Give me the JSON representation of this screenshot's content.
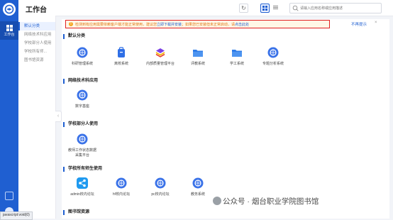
{
  "app": {
    "nav_label": "工作台",
    "title": "工作台"
  },
  "toolbar": {
    "search_placeholder": "请输入应用名称或应用描述"
  },
  "sidebar": {
    "items": [
      {
        "label": "默认分类",
        "active": true
      },
      {
        "label": "网络技术科应用",
        "active": false
      },
      {
        "label": "学校部分人使用",
        "active": false
      },
      {
        "label": "学校所有师...",
        "active": false
      },
      {
        "label": "图书馆资源",
        "active": false
      }
    ]
  },
  "notice": {
    "text_before": "检测到有应用需要依赖客户端才能正常使用，建议您",
    "link1": "立即下载并安装",
    "text_mid": "；如果您已安装但未正常启动，请",
    "link2": "点击此处",
    "no_remind": "不再提示",
    "close": "×"
  },
  "sections": [
    {
      "title": "默认分类",
      "apps": [
        {
          "label": "科研管理系统",
          "icon": "globe-icon"
        },
        {
          "label": "离校系统",
          "icon": "bag-icon"
        },
        {
          "label": "内部质量管理平台",
          "icon": "layers-icon"
        },
        {
          "label": "评教系统",
          "icon": "folder-icon"
        },
        {
          "label": "学工系统",
          "icon": "folder-icon"
        },
        {
          "label": "专题分析系统",
          "icon": "globe-icon"
        }
      ]
    },
    {
      "title": "网络技术科应用",
      "apps": [
        {
          "label": "数字基座",
          "icon": "globe-icon"
        }
      ]
    },
    {
      "title": "学校部分人使用",
      "apps": [
        {
          "label": "教师工作状态数据\n采集平台",
          "icon": "globe-icon"
        }
      ]
    },
    {
      "title": "学校所有师生使用",
      "apps": [
        {
          "label": "admin校内论坛",
          "icon": "share-icon"
        },
        {
          "label": "hf校内论坛",
          "icon": "globe-icon"
        },
        {
          "label": "pc校内论坛",
          "icon": "globe-icon"
        },
        {
          "label": "教务系统",
          "icon": "globe-icon"
        }
      ]
    },
    {
      "title": "图书馆资源",
      "apps": []
    }
  ],
  "watermark": "公众号 · 烟台职业学院图书馆",
  "status_bar": "javascript:void(0)",
  "colors": {
    "primary": "#1f5fd1",
    "notice_border": "#e02020",
    "notice_bg": "#fff7e6",
    "notice_text": "#e07a1a"
  }
}
